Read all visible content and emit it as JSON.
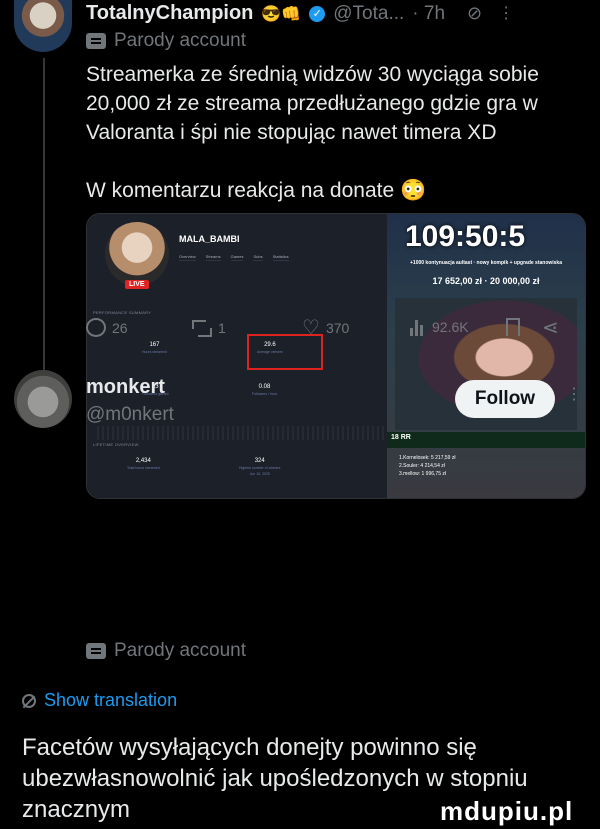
{
  "tweet1": {
    "display_name": "TotalnyChampion",
    "name_emojis": "😎👊",
    "handle": "@Tota...",
    "time": "· 7h",
    "parody_label": "Parody account",
    "text_lines": [
      "Streamerka ze średnią widzów 30 wyciąga sobie",
      "20,000 zł ze streama przedłużanego gdzie gra w",
      "Valoranta i śpi nie stopując nawet timera XD"
    ],
    "text_line2": "W komentarzu reakcja na donate 😳",
    "media": {
      "channel_name": "MALA_BAMBI",
      "live_badge": "LIVE",
      "tabs": [
        "Overview",
        "Streams",
        "Games",
        "Subs",
        "Statistics"
      ],
      "performance_title": "PERFORMANCE SUMMARY",
      "lifetime_title": "LIFETIME OVERVIEW",
      "stats": [
        {
          "value": "167",
          "caption": "Hours streamed"
        },
        {
          "value": "29.6",
          "caption": "Average viewers"
        },
        {
          "value": "13",
          "caption": "Followers gained"
        },
        {
          "value": "0.08",
          "caption": "Followers / hour"
        },
        {
          "value": "2,434",
          "caption": "Total hours streamed"
        },
        {
          "value": "324",
          "caption": "Highest number of viewers"
        }
      ],
      "stats_date": "Jun 15, 2025",
      "timer": "109:50:5",
      "timer_sub": "+1000 kontynuacja aultast · nowy kompik + upgrade stanowiska",
      "money": "17 652,00 zł · 20 000,00 zł",
      "strip": "18 RR",
      "donors": [
        "1.Kornelosek: 5 217,59 zł",
        "2.Souler: 4 214,54 zł",
        "3.mellow: 1 996,75 zł"
      ]
    },
    "actions": {
      "replies": "26",
      "reposts": "1",
      "likes": "370",
      "views": "92.6K"
    }
  },
  "tweet2": {
    "display_name": "monkert",
    "handle": "@m0nkert",
    "parody_label": "Parody account",
    "follow_label": "Follow",
    "translation_label": "Show translation",
    "text_lines": [
      "Facetów wysyłających donejty powinno się",
      "ubezwłasnowolnić jak upośledzonych w stopniu",
      "znacznym"
    ]
  },
  "watermark": "mdupiu.pl",
  "colors": {
    "background": "#000000",
    "text": "#e7e9ea",
    "muted": "#71767b",
    "link": "#1d9bf0"
  }
}
